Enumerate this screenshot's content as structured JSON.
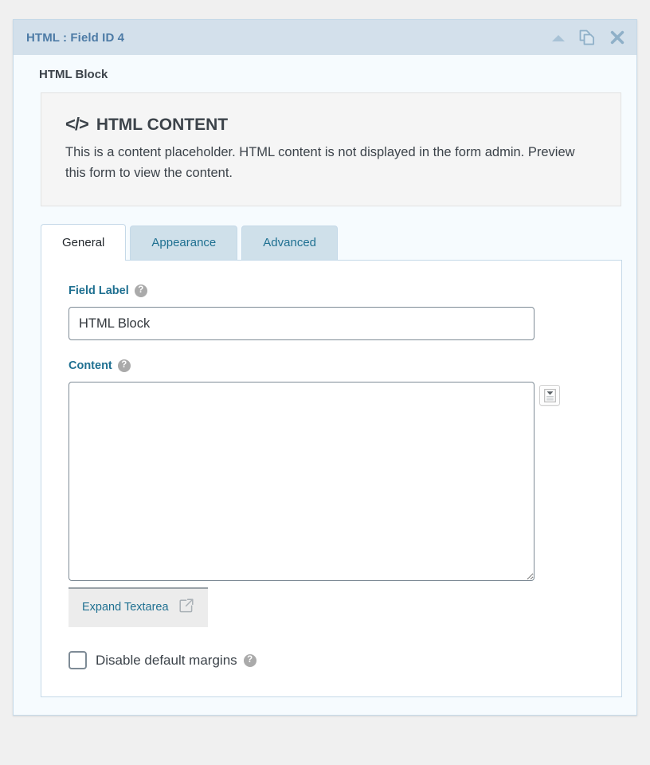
{
  "panel": {
    "header": {
      "title": "HTML : Field ID 4",
      "icons": [
        {
          "name": "collapse-icon",
          "glyph": "collapse"
        },
        {
          "name": "duplicate-icon",
          "glyph": "duplicate"
        },
        {
          "name": "close-icon",
          "glyph": "close"
        }
      ]
    },
    "block_title": "HTML Block",
    "placeholder": {
      "code_glyph": "</>",
      "heading": "HTML CONTENT",
      "description": "This is a content placeholder. HTML content is not displayed in the form admin. Preview this form to view the content."
    },
    "tabs": [
      {
        "label": "General",
        "active": true
      },
      {
        "label": "Appearance",
        "active": false
      },
      {
        "label": "Advanced",
        "active": false
      }
    ],
    "general_tab": {
      "field_label": {
        "label": "Field Label",
        "help": "?",
        "value": "HTML Block",
        "placeholder": ""
      },
      "content": {
        "label": "Content",
        "help": "?",
        "value": "",
        "placeholder": "",
        "merge_tag_icon": "insert-merge-tag-icon",
        "expand_button": {
          "label": "Expand Textarea",
          "icon": "expand-icon"
        }
      },
      "disable_margins": {
        "label": "Disable default margins",
        "help": "?",
        "checked": false
      }
    }
  },
  "colors": {
    "header_bg": "#d3e0eb",
    "header_text": "#4d7ba6",
    "panel_bg": "#f6fbfe",
    "panel_border": "#c5d9e8",
    "tab_inactive_bg": "#cfe0ea",
    "tab_active_bg": "#ffffff",
    "label_accent": "#1f7091",
    "page_bg": "#f0f0f0",
    "placeholder_bg": "#f5f5f5"
  }
}
